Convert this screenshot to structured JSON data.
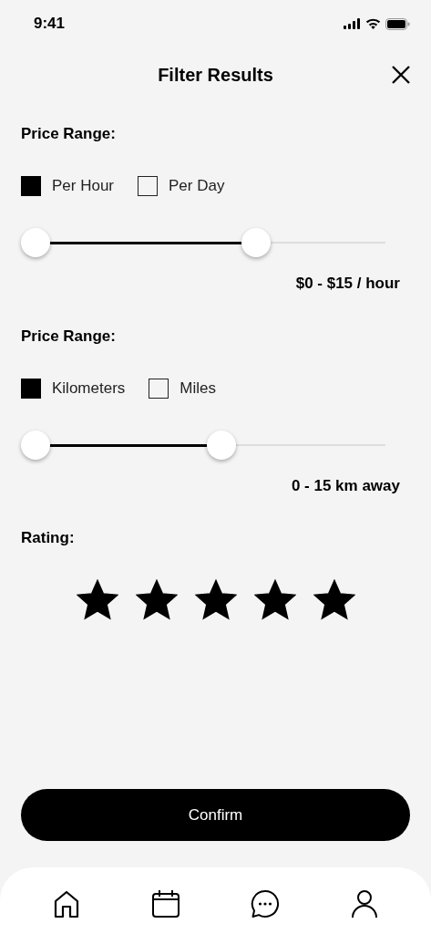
{
  "status_bar": {
    "time": "9:41"
  },
  "header": {
    "title": "Filter Results"
  },
  "sections": [
    {
      "label": "Price Range:",
      "options": [
        {
          "label": "Per Hour",
          "checked": true
        },
        {
          "label": "Per Day",
          "checked": false
        }
      ],
      "slider": {
        "thumbs": [
          {
            "level": 0
          },
          {
            "level": 0.63
          }
        ]
      },
      "reading": "$0 - $15 / hour"
    },
    {
      "label": "Price Range:",
      "options": [
        {
          "label": "Kilometers",
          "checked": true
        },
        {
          "label": "Miles",
          "checked": false
        }
      ],
      "slider": {
        "thumbs": [
          {
            "level": 0
          },
          {
            "level": 0.53
          }
        ]
      },
      "reading": "0 - 15 km away"
    }
  ],
  "rating": {
    "label": "Rating:",
    "stars": 5
  },
  "confirm_button": {
    "label": "Confirm"
  },
  "tab_bar": {
    "items": [
      {
        "kind": "home"
      },
      {
        "kind": "calendar"
      },
      {
        "kind": "chat"
      },
      {
        "kind": "profile"
      }
    ]
  }
}
